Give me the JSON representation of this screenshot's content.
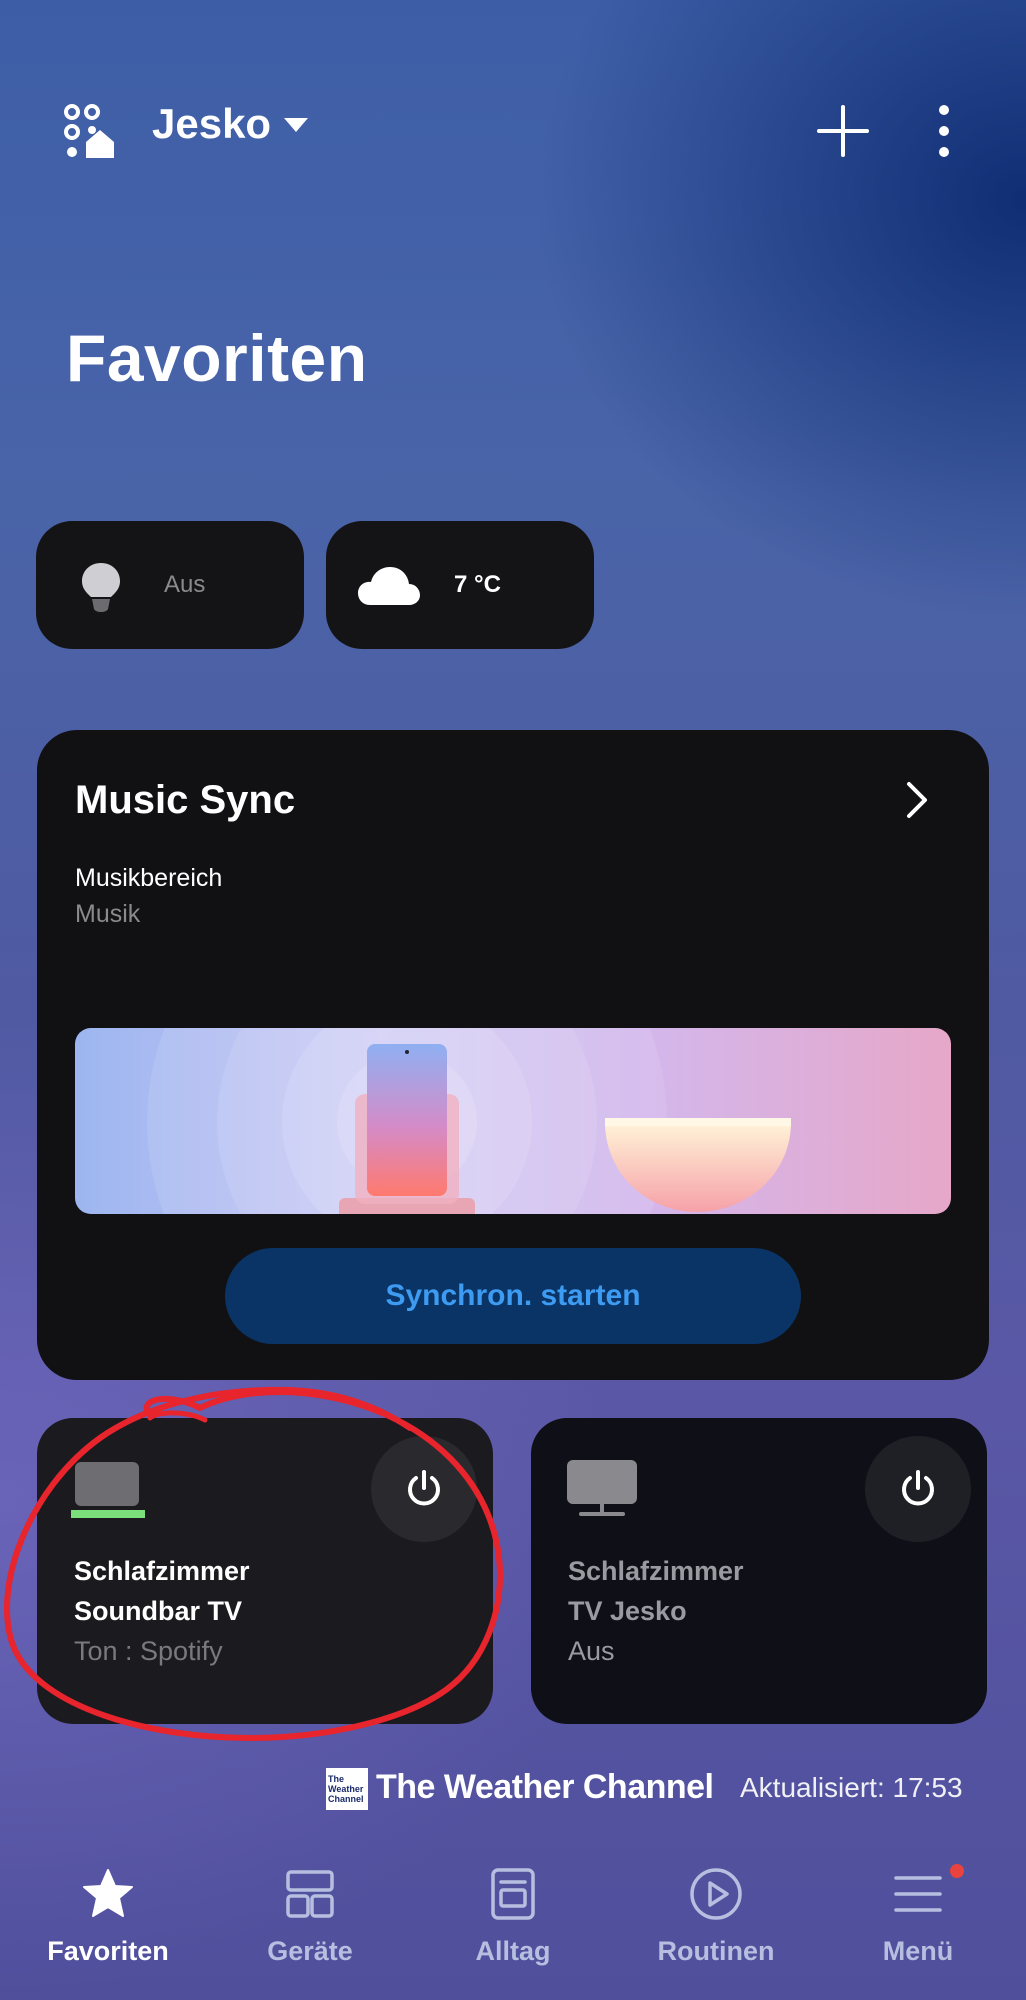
{
  "header": {
    "home_name": "Jesko",
    "icons": [
      "smartthings-home-icon",
      "caret-down-icon",
      "plus-icon",
      "more-vertical-icon"
    ]
  },
  "page": {
    "title": "Favoriten"
  },
  "quick_tiles": {
    "light": {
      "status": "Aus",
      "icon": "lightbulb-icon"
    },
    "weather": {
      "temperature": "7 °C",
      "icon": "cloud-icon"
    }
  },
  "music_sync": {
    "title": "Music Sync",
    "subtitle": "Musikbereich",
    "detail": "Musik",
    "button_label": "Synchron. starten",
    "button_color": "#3d9bf2"
  },
  "devices": [
    {
      "line1": "Schlafzimmer",
      "line2": "Soundbar TV",
      "status": "Ton : Spotify",
      "icon": "soundbar-icon",
      "active_color": "#7be07b"
    },
    {
      "line1": "Schlafzimmer",
      "line2": "TV Jesko",
      "status": "Aus",
      "icon": "tv-icon"
    }
  ],
  "footer": {
    "weather_logo_text": [
      "The",
      "Weather",
      "Channel"
    ],
    "weather_brand": "The Weather Channel",
    "updated": "Aktualisiert: 17:53"
  },
  "nav": {
    "items": [
      {
        "label": "Favoriten",
        "icon": "star-icon",
        "active": true
      },
      {
        "label": "Geräte",
        "icon": "devices-grid-icon",
        "active": false
      },
      {
        "label": "Alltag",
        "icon": "daily-board-icon",
        "active": false
      },
      {
        "label": "Routinen",
        "icon": "play-circle-icon",
        "active": false
      },
      {
        "label": "Menü",
        "icon": "menu-icon",
        "active": false,
        "badge_color": "#e8433e"
      }
    ]
  },
  "annotation_color": "#e8242c"
}
